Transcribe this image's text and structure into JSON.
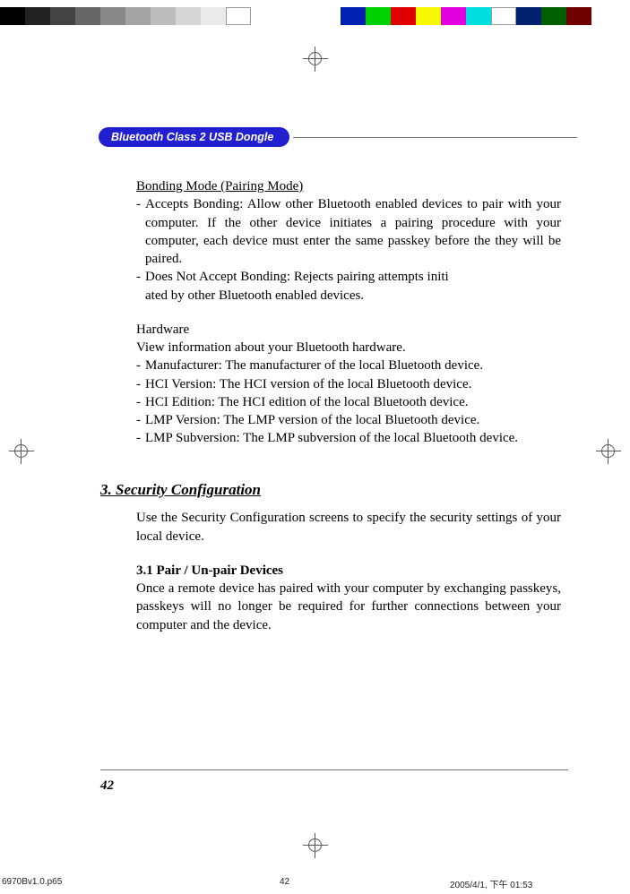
{
  "colorBar": {
    "colors": [
      "#000000",
      "#222222",
      "#444444",
      "#666666",
      "#888888",
      "#a3a3a3",
      "#bcbcbc",
      "#d6d6d6",
      "#eaeaea",
      "#ffffff",
      "#0020b0",
      "#00d000",
      "#e00000",
      "#f8f800",
      "#e000e0",
      "#00e0e0",
      "#ffffff",
      "#002070",
      "#006000",
      "#700000"
    ]
  },
  "header": {
    "badge": "Bluetooth Class 2 USB Dongle"
  },
  "content": {
    "bondingTitle": "Bonding Mode (Pairing Mode)",
    "bonding1": "Accepts Bonding: Allow other Bluetooth enabled devices to pair with your computer. If the other device initiates a pairing procedure with your computer, each device must enter the same passkey before the they will be paired.",
    "bonding2Line1": "Does Not Accept Bonding: Rejects pairing attempts initi",
    "bonding2Line2": "ated by other Bluetooth enabled devices.",
    "hwTitle": "Hardware",
    "hwIntro": "View information about your Bluetooth hardware.",
    "hw1": "Manufacturer: The manufacturer of the local Bluetooth device.",
    "hw2": "HCI Version: The HCI version of the local Bluetooth device.",
    "hw3": "HCI Edition:  The HCI edition of the local Bluetooth device.",
    "hw4": "LMP Version: The LMP version of the local Bluetooth device.",
    "hw5": "LMP Subversion: The LMP subversion of the local Bluetooth device.",
    "sec3Heading": "3. Security Configuration",
    "sec3Intro": "Use the Security Configuration screens to specify the security settings of your local device.",
    "sec31Heading": "3.1 Pair / Un-pair Devices",
    "sec31Body": "Once a remote device has paired with your computer by exchanging passkeys, passkeys will no longer be required for further connections between your computer and the device."
  },
  "pageNumber": "42",
  "printFooter": {
    "file": "6970Bv1.0.p65",
    "page": "42",
    "datetime": "2005/4/1, 下午 01:53"
  }
}
